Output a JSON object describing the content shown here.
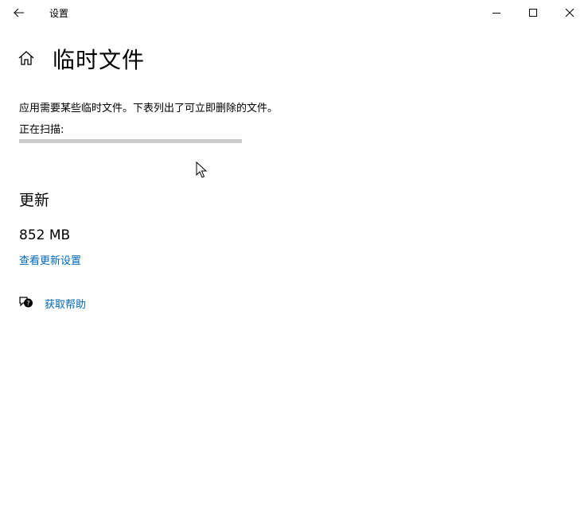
{
  "window": {
    "title": "设置",
    "back_icon": "arrow-left-icon",
    "controls": [
      "minimize-icon",
      "maximize-icon",
      "close-icon"
    ]
  },
  "page": {
    "home_icon": "home-icon",
    "title": "临时文件",
    "description": "应用需要某些临时文件。下表列出了可立即删除的文件。",
    "scan_label": "正在扫描:",
    "scan_progress": 0
  },
  "updates_section": {
    "title": "更新",
    "size": "852 MB",
    "link_label": "查看更新设置"
  },
  "help": {
    "icon": "help-chat-icon",
    "label": "获取帮助"
  },
  "colors": {
    "link": "#0067b8",
    "progress_track": "#cccccc",
    "background": "#ffffff"
  }
}
